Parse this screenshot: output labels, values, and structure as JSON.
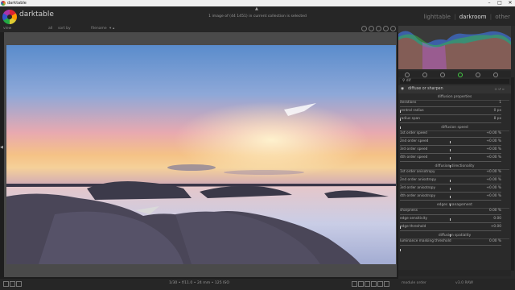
{
  "window": {
    "title": "darktable",
    "controls": [
      "–",
      "□",
      "✕"
    ]
  },
  "header": {
    "brand": "darktable",
    "info": "1 image of (44 1451) in current collection is selected",
    "views": [
      {
        "label": "lighttable",
        "active": false
      },
      {
        "label": "darkroom",
        "active": true
      },
      {
        "label": "other",
        "active": false
      }
    ]
  },
  "filterbar": {
    "view_label": "view",
    "filter_all": "all",
    "sort_by": "sort by",
    "sort_field": "filename"
  },
  "right_panel": {
    "search_value": "dif",
    "module_title": "diffuse or sharpen",
    "sections": [
      {
        "title": "diffusion properties",
        "params": [
          {
            "label": "iterations",
            "value": "1"
          },
          {
            "label": "central radius",
            "value": "0 px"
          },
          {
            "label": "radius span",
            "value": "8 px"
          }
        ]
      },
      {
        "title": "diffusion speed",
        "params": [
          {
            "label": "1st order speed",
            "value": "+0.00 %"
          },
          {
            "label": "2nd order speed",
            "value": "+0.00 %"
          },
          {
            "label": "3rd order speed",
            "value": "+0.00 %"
          },
          {
            "label": "4th order speed",
            "value": "+0.00 %"
          }
        ]
      },
      {
        "title": "diffusion directionality",
        "params": [
          {
            "label": "1st order anisotropy",
            "value": "+0.00 %"
          },
          {
            "label": "2nd order anisotropy",
            "value": "+0.00 %"
          },
          {
            "label": "3rd order anisotropy",
            "value": "+0.00 %"
          },
          {
            "label": "4th order anisotropy",
            "value": "+0.00 %"
          }
        ]
      },
      {
        "title": "edges management",
        "params": [
          {
            "label": "sharpness",
            "value": "0.00 %"
          },
          {
            "label": "edge sensitivity",
            "value": "0.00"
          },
          {
            "label": "edge threshold",
            "value": "+0.00"
          }
        ]
      },
      {
        "title": "diffusion spatiality",
        "params": [
          {
            "label": "luminance masking threshold",
            "value": "0.00 %"
          }
        ]
      }
    ]
  },
  "bottom_bar": {
    "exif": "1/30 • f/11.0 • 24 mm • 125 ISO",
    "module_order": "module order",
    "version": "v3.0 RAW"
  },
  "colors": {
    "accent": "#cfcfcf",
    "panel": "#2a2a2a",
    "background": "#1e1e1e"
  }
}
